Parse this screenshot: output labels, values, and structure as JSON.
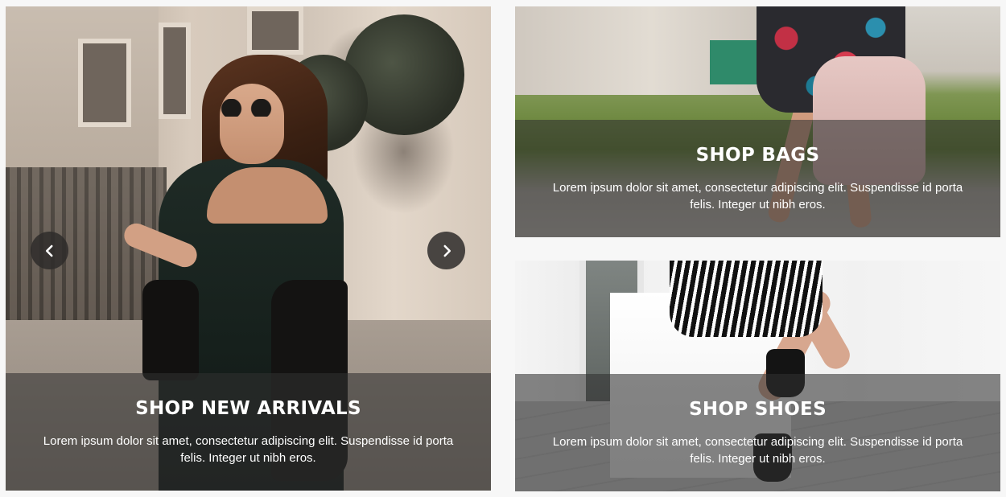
{
  "promos": {
    "new_arrivals": {
      "title": "SHOP NEW ARRIVALS",
      "description": "Lorem ipsum dolor sit amet, consectetur adipiscing elit. Suspendisse id porta felis. Integer ut nibh eros."
    },
    "bags": {
      "title": "SHOP BAGS",
      "description": "Lorem ipsum dolor sit amet, consectetur adipiscing elit. Suspendisse id porta felis. Integer ut nibh eros."
    },
    "shoes": {
      "title": "SHOP SHOES",
      "description": "Lorem ipsum dolor sit amet, consectetur adipiscing elit. Suspendisse id porta felis. Integer ut nibh eros."
    }
  },
  "carousel": {
    "prev_icon": "chevron-left-icon",
    "next_icon": "chevron-right-icon"
  },
  "colors": {
    "overlay": "#303030",
    "text": "#ffffff",
    "page_background": "#f7f7f7"
  }
}
